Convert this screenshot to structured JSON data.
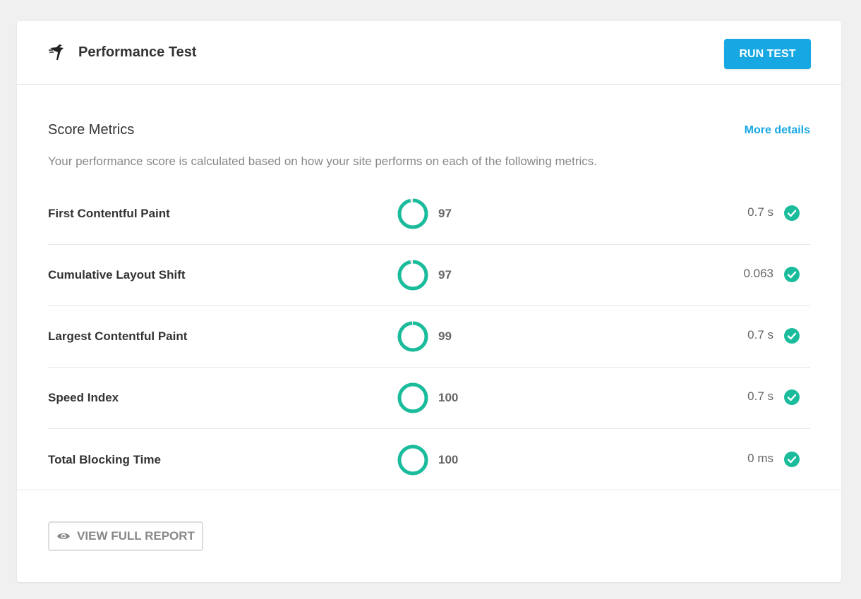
{
  "header": {
    "title": "Performance Test",
    "icon": "hummingbird-icon",
    "run_button": "RUN TEST"
  },
  "score_metrics": {
    "title": "Score Metrics",
    "more_link": "More details",
    "description": "Your performance score is calculated based on how your site performs on each of the following metrics.",
    "metrics": [
      {
        "name": "First Contentful Paint",
        "score": "97",
        "score_value": 97,
        "value": "0.7 s",
        "status": "passed"
      },
      {
        "name": "Cumulative Layout Shift",
        "score": "97",
        "score_value": 97,
        "value": "0.063",
        "status": "passed"
      },
      {
        "name": "Largest Contentful Paint",
        "score": "99",
        "score_value": 99,
        "value": "0.7 s",
        "status": "passed"
      },
      {
        "name": "Speed Index",
        "score": "100",
        "score_value": 100,
        "value": "0.7 s",
        "status": "passed"
      },
      {
        "name": "Total Blocking Time",
        "score": "100",
        "score_value": 100,
        "value": "0 ms",
        "status": "passed"
      }
    ]
  },
  "footer": {
    "report_button": "VIEW FULL REPORT",
    "report_icon": "eye-icon"
  },
  "colors": {
    "accent": "#17a8e3",
    "success": "#1abc9c",
    "ring_track": "#e6e6e6"
  }
}
